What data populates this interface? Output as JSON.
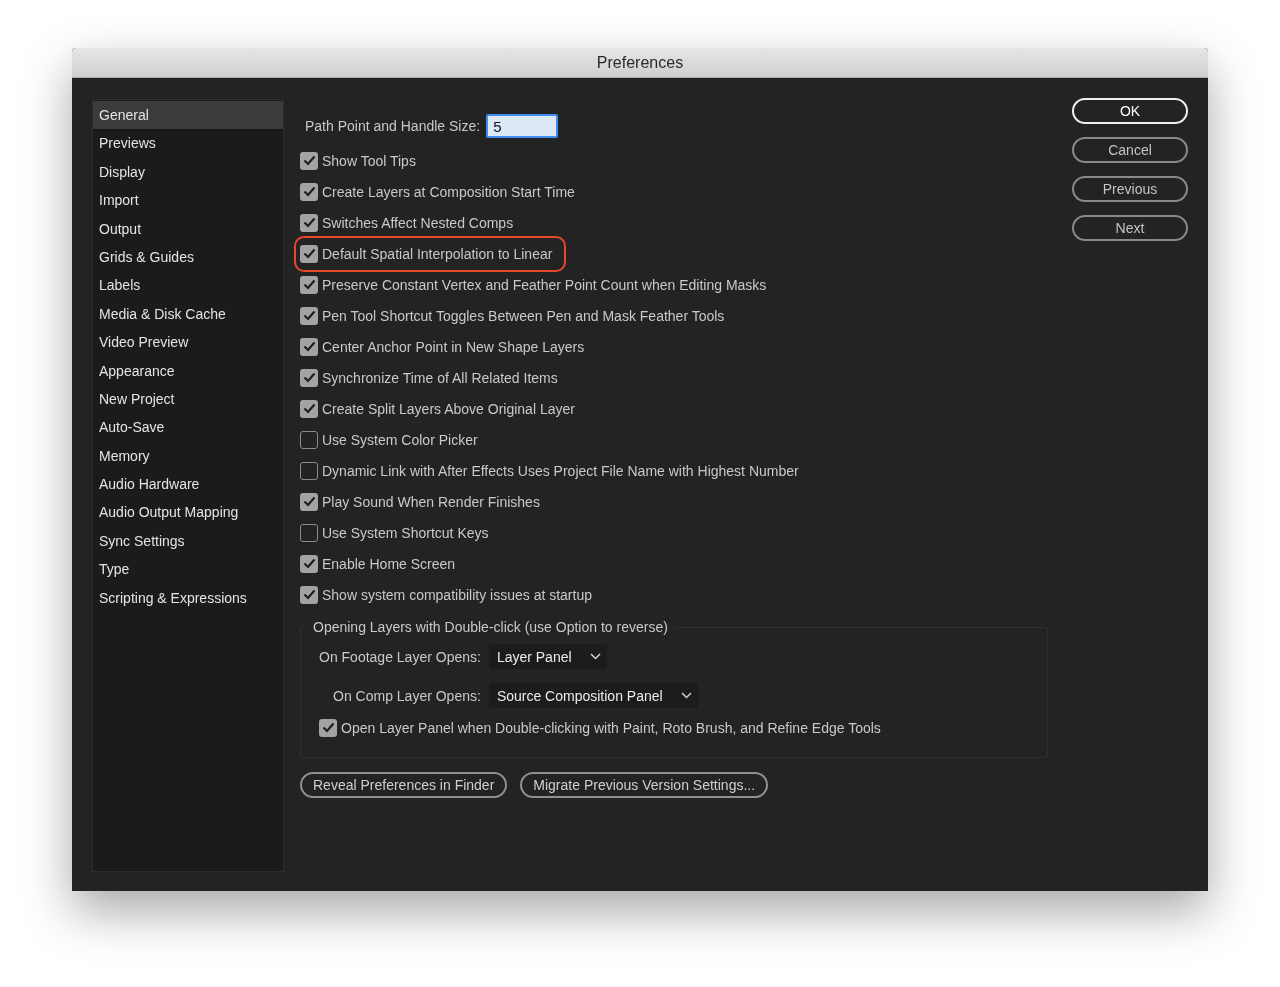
{
  "window": {
    "title": "Preferences"
  },
  "sidebar": {
    "items": [
      {
        "label": "General",
        "selected": true
      },
      {
        "label": "Previews",
        "selected": false
      },
      {
        "label": "Display",
        "selected": false
      },
      {
        "label": "Import",
        "selected": false
      },
      {
        "label": "Output",
        "selected": false
      },
      {
        "label": "Grids & Guides",
        "selected": false
      },
      {
        "label": "Labels",
        "selected": false
      },
      {
        "label": "Media & Disk Cache",
        "selected": false
      },
      {
        "label": "Video Preview",
        "selected": false
      },
      {
        "label": "Appearance",
        "selected": false
      },
      {
        "label": "New Project",
        "selected": false
      },
      {
        "label": "Auto-Save",
        "selected": false
      },
      {
        "label": "Memory",
        "selected": false
      },
      {
        "label": "Audio Hardware",
        "selected": false
      },
      {
        "label": "Audio Output Mapping",
        "selected": false
      },
      {
        "label": "Sync Settings",
        "selected": false
      },
      {
        "label": "Type",
        "selected": false
      },
      {
        "label": "Scripting & Expressions",
        "selected": false
      }
    ]
  },
  "path_point_size": {
    "label": "Path Point and Handle Size:",
    "value": "5"
  },
  "options": [
    {
      "label": "Show Tool Tips",
      "checked": true,
      "highlighted": false
    },
    {
      "label": "Create Layers at Composition Start Time",
      "checked": true,
      "highlighted": false
    },
    {
      "label": "Switches Affect Nested Comps",
      "checked": true,
      "highlighted": false
    },
    {
      "label": "Default Spatial Interpolation to Linear",
      "checked": true,
      "highlighted": true
    },
    {
      "label": "Preserve Constant Vertex and Feather Point Count when Editing Masks",
      "checked": true,
      "highlighted": false
    },
    {
      "label": "Pen Tool Shortcut Toggles Between Pen and Mask Feather Tools",
      "checked": true,
      "highlighted": false
    },
    {
      "label": "Center Anchor Point in New Shape Layers",
      "checked": true,
      "highlighted": false
    },
    {
      "label": "Synchronize Time of All Related Items",
      "checked": true,
      "highlighted": false
    },
    {
      "label": "Create Split Layers Above Original Layer",
      "checked": true,
      "highlighted": false
    },
    {
      "label": "Use System Color Picker",
      "checked": false,
      "highlighted": false
    },
    {
      "label": "Dynamic Link with After Effects Uses Project File Name with Highest Number",
      "checked": false,
      "highlighted": false
    },
    {
      "label": "Play Sound When Render Finishes",
      "checked": true,
      "highlighted": false
    },
    {
      "label": "Use System Shortcut Keys",
      "checked": false,
      "highlighted": false
    },
    {
      "label": "Enable Home Screen",
      "checked": true,
      "highlighted": false
    },
    {
      "label": "Show system compatibility issues at startup",
      "checked": true,
      "highlighted": false
    }
  ],
  "opening_group": {
    "title": "Opening Layers with Double-click (use Option to reverse)",
    "fields": [
      {
        "label": "On Footage Layer Opens:",
        "value": "Layer Panel"
      },
      {
        "label": "On Comp Layer Opens:",
        "value": "Source Composition Panel"
      }
    ],
    "option": {
      "label": "Open Layer Panel when Double-clicking with Paint, Roto Brush, and Refine Edge Tools",
      "checked": true
    }
  },
  "footer_buttons": [
    "Reveal Preferences in Finder",
    "Migrate Previous Version Settings..."
  ],
  "dialog_buttons": [
    {
      "label": "OK",
      "default": true
    },
    {
      "label": "Cancel",
      "default": false
    },
    {
      "label": "Previous",
      "default": false
    },
    {
      "label": "Next",
      "default": false
    }
  ]
}
